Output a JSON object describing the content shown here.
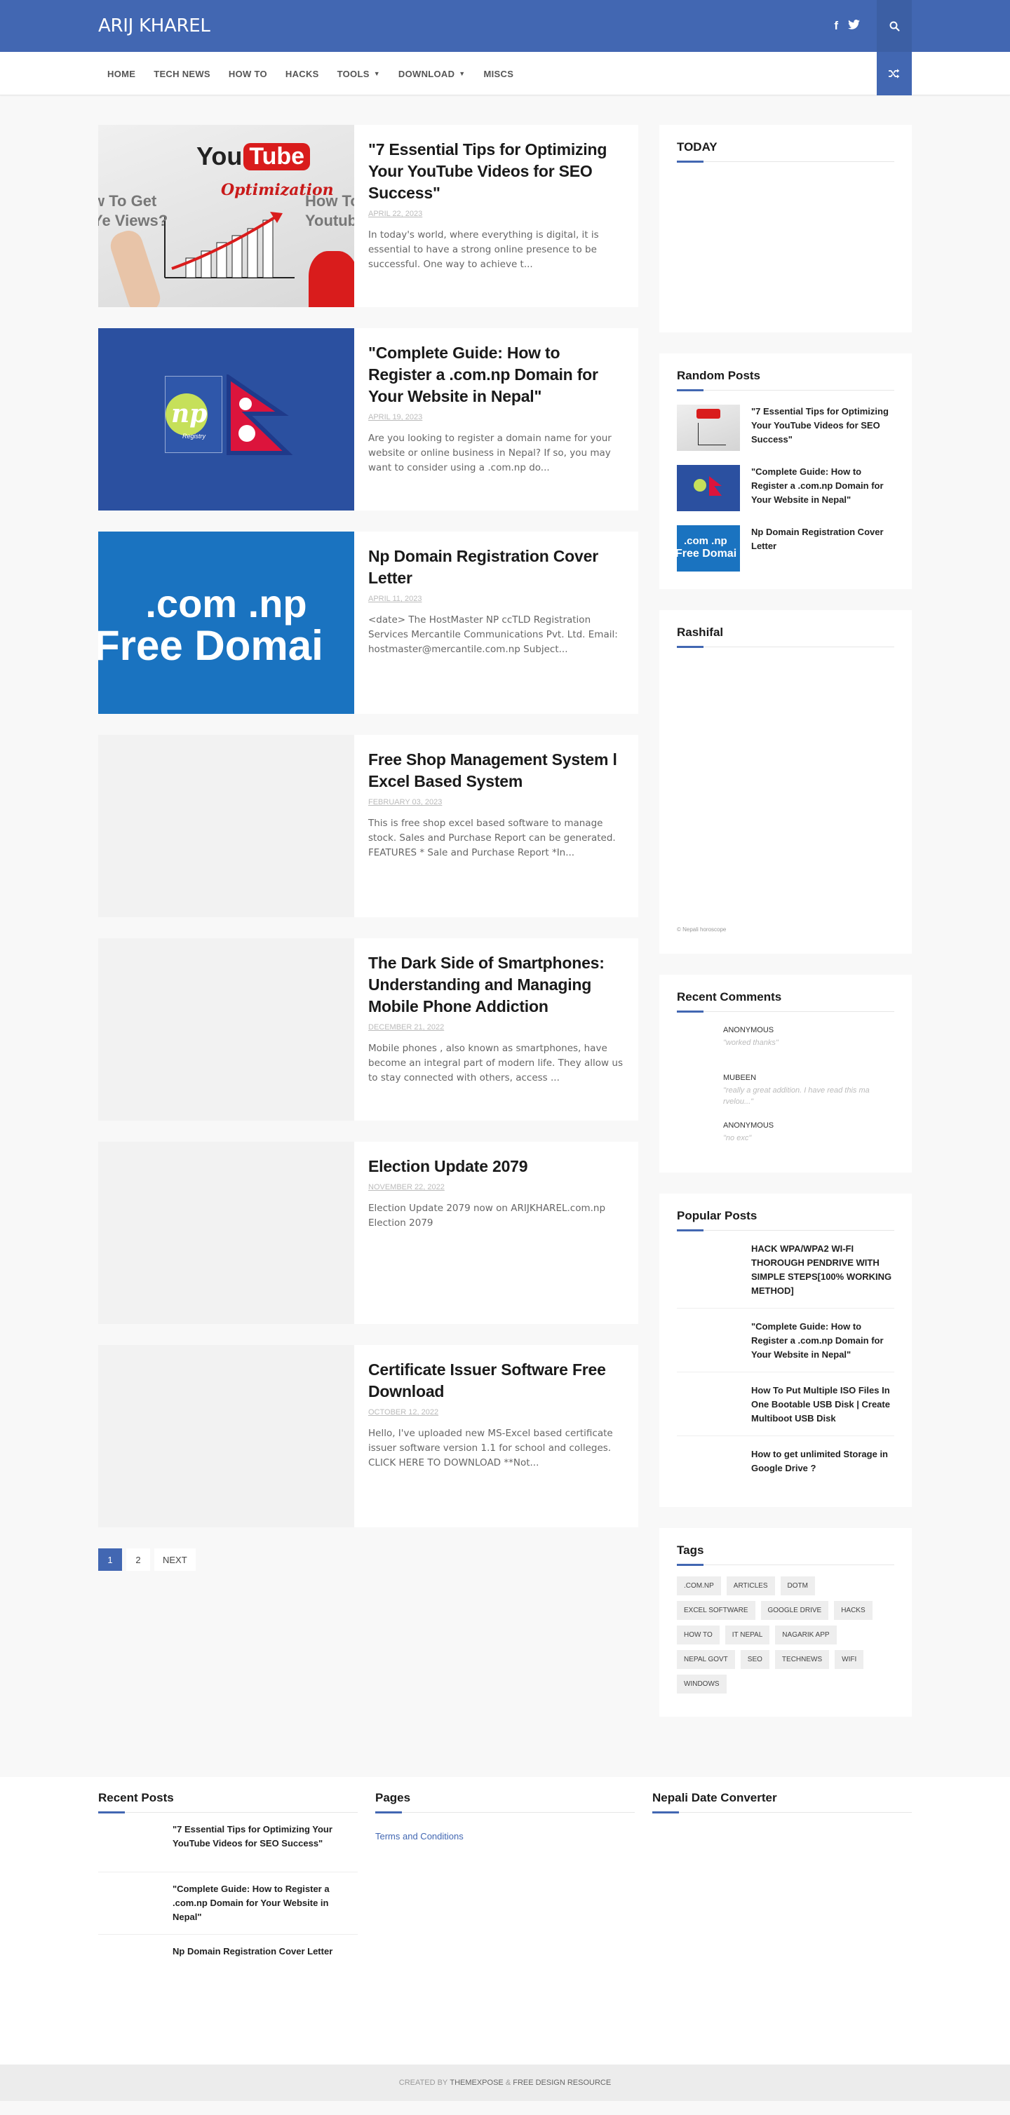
{
  "site": {
    "logo": "ARIJ KHAREL"
  },
  "nav": {
    "items": [
      {
        "label": "HOME"
      },
      {
        "label": "TECH NEWS"
      },
      {
        "label": "HOW TO"
      },
      {
        "label": "HACKS"
      },
      {
        "label": "TOOLS"
      },
      {
        "label": "DOWNLOAD"
      },
      {
        "label": "MISCS"
      }
    ]
  },
  "posts": [
    {
      "title": "\"7 Essential Tips for Optimizing Your YouTube Videos for SEO Success\"",
      "date": "APRIL 22, 2023",
      "excerpt": "In today's world, where everything is digital, it is essential to have a strong online presence to be successful. One way to achieve t...",
      "thumb_text": {
        "you": "You",
        "tube": "Tube",
        "opt": "Optimization",
        "left": "w To Get\nYe Views?",
        "right": "How To\nYoutube"
      }
    },
    {
      "title": "\"Complete Guide: How to Register a .com.np Domain for Your Website in Nepal\"",
      "date": "APRIL 19, 2023",
      "excerpt": "Are you looking to register a domain name for your website or online business in Nepal? If so, you may want to consider using a .com.np do...",
      "thumb_text": {
        "np": "np",
        "registry": "Registry"
      }
    },
    {
      "title": "Np Domain Registration Cover Letter",
      "date": "APRIL 11, 2023",
      "excerpt": "<date> The HostMaster NP ccTLD Registration Services Mercantile Communications Pvt. Ltd. Email: hostmaster@mercantile.com.np Subject...",
      "thumb_text": {
        "line1": ".com .np",
        "line2": "Free Domai"
      }
    },
    {
      "title": "Free Shop Management System l Excel Based System",
      "date": "FEBRUARY 03, 2023",
      "excerpt": "This is free shop excel based software to manage stock. Sales and Purchase Report can be generated. FEATURES * Sale and Purchase Report *In..."
    },
    {
      "title": "The Dark Side of Smartphones: Understanding and Managing Mobile Phone Addiction",
      "date": "DECEMBER 21, 2022",
      "excerpt": "Mobile phones , also known as smartphones, have become an integral part of modern life. They allow us to stay connected with others, access ..."
    },
    {
      "title": "Election Update 2079",
      "date": "NOVEMBER 22, 2022",
      "excerpt": "Election Update 2079 now  on  ARIJKHAREL.com.np Election 2079"
    },
    {
      "title": "Certificate Issuer Software Free Download",
      "date": "OCTOBER 12, 2022",
      "excerpt": "Hello, I've uploaded new MS-Excel based certificate issuer software version 1.1  for school and colleges. CLICK HERE TO DOWNLOAD **Not..."
    }
  ],
  "pagination": {
    "pages": [
      "1",
      "2"
    ],
    "next": "NEXT"
  },
  "sidebar": {
    "today": {
      "title": "TODAY"
    },
    "random_posts": {
      "title": "Random Posts",
      "items": [
        {
          "title": "\"7 Essential Tips for Optimizing Your YouTube Videos for SEO Success\""
        },
        {
          "title": "\"Complete Guide: How to Register a .com.np Domain for Your Website in Nepal\""
        },
        {
          "title": "Np Domain Registration Cover Letter"
        }
      ]
    },
    "rashifal": {
      "title": "Rashifal",
      "note": "© Nepali horoscope"
    },
    "recent_comments": {
      "title": "Recent Comments",
      "items": [
        {
          "author": "ANONYMOUS",
          "text": "\"worked thanks\""
        },
        {
          "author": "MUBEEN",
          "text": "\"really a great addition. I have read this ma rvelou...\""
        },
        {
          "author": "ANONYMOUS",
          "text": "\"no exc\""
        }
      ]
    },
    "popular_posts": {
      "title": "Popular Posts",
      "items": [
        {
          "title": "HACK WPA/WPA2 WI-FI THOROUGH PENDRIVE WITH SIMPLE STEPS[100% WORKING METHOD]"
        },
        {
          "title": "\"Complete Guide: How to Register a .com.np Domain for Your Website in Nepal\""
        },
        {
          "title": "How To Put Multiple ISO Files In One Bootable USB Disk | Create Multiboot USB Disk"
        },
        {
          "title": "How to get unlimited Storage in Google Drive ?"
        }
      ]
    },
    "tags": {
      "title": "Tags",
      "items": [
        ".COM.NP",
        "ARTICLES",
        "DOTM",
        "EXCEL SOFTWARE",
        "GOOGLE DRIVE",
        "HACKS",
        "HOW TO",
        "IT NEPAL",
        "NAGARIK APP",
        "NEPAL GOVT",
        "SEO",
        "TECHNEWS",
        "WIFI",
        "WINDOWS"
      ]
    }
  },
  "footer": {
    "recent_posts": {
      "title": "Recent Posts",
      "items": [
        {
          "title": "\"7 Essential Tips for Optimizing Your YouTube Videos for SEO Success\""
        },
        {
          "title": "\"Complete Guide: How to Register a .com.np Domain for Your Website in Nepal\""
        },
        {
          "title": "Np Domain Registration Cover Letter"
        }
      ]
    },
    "pages": {
      "title": "Pages",
      "link": "Terms and Conditions"
    },
    "date_converter": {
      "title": "Nepali Date Converter"
    },
    "credit": {
      "prefix": "CREATED BY ",
      "brand": "THEMEXPOSE",
      "amp": " & ",
      "resource": "FREE DESIGN RESOURCE"
    }
  },
  "colors": {
    "accent": "#4267b2",
    "background": "#f8f8f8"
  }
}
